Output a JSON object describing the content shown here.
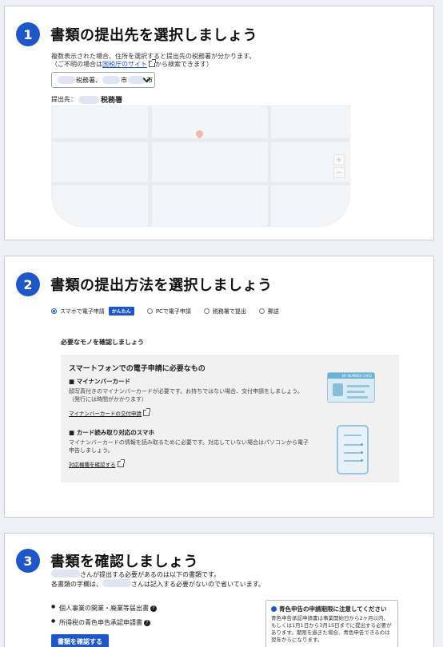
{
  "step1": {
    "number": "1",
    "title": "書類の提出先を選択しましょう",
    "help_line1": "複数表示された場合、住所を選択すると提出先の税務署が分かります。",
    "help_line2_pre": "（ご不明の場合は",
    "help_link": "国税庁のサイト",
    "help_line2_post": "から検索できます）",
    "select_value_1": "税務署、",
    "select_value_2": "市",
    "select_value_3": "市",
    "office_label": "提出先：",
    "office_suffix": "税務署"
  },
  "step2": {
    "number": "2",
    "title": "書類の提出方法を選択しましょう",
    "methods": [
      {
        "label": "スマホで電子申請",
        "selected": true,
        "badge": "かんたん"
      },
      {
        "label": "PCで電子申請",
        "selected": false
      },
      {
        "label": "税務署で提出",
        "selected": false
      },
      {
        "label": "郵送",
        "selected": false
      }
    ],
    "subheading": "必要なモノを確認しましょう",
    "box_title": "スマートフォンでの電子申請に必要なもの",
    "card_label": "MY NUMBER CARD",
    "requirements": [
      {
        "title": "■ マイナンバーカード",
        "desc": "顔写真付きのマイナンバーカードが必要です。お持ちではない場合、交付申請をしましょう。（発行には時間がかかります）",
        "link": "マイナンバーカードの交付申請"
      },
      {
        "title": "■ カード読み取り対応のスマホ",
        "desc": "マイナンバーカードの情報を読み取るために必要です。対応していない場合はパソコンから電子申告しましょう。",
        "link": "対応機種を確認する"
      }
    ]
  },
  "step3": {
    "number": "3",
    "title": "書類を確認しましょう",
    "note_line1": "さんが提出する必要があるのは以下の書類です。",
    "note_line2_pre": "各書類の字欄は、",
    "note_line2_post": "さんは記入する必要がないので省いています。",
    "docs": [
      "個人事業の開業・廃業等届出書",
      "所得税の青色申告承認申請書"
    ],
    "confirm_button": "書類を確認する",
    "warning_title": "青色申告の申請期限に注意してください",
    "warning_body": "青色申告承認申請書は事業開始日から2ヶ月以内、もしくは1月1日から3月15日までに提出する必要があります。期限を過ぎた場合、青色申告できるのは翌年からになります。"
  }
}
